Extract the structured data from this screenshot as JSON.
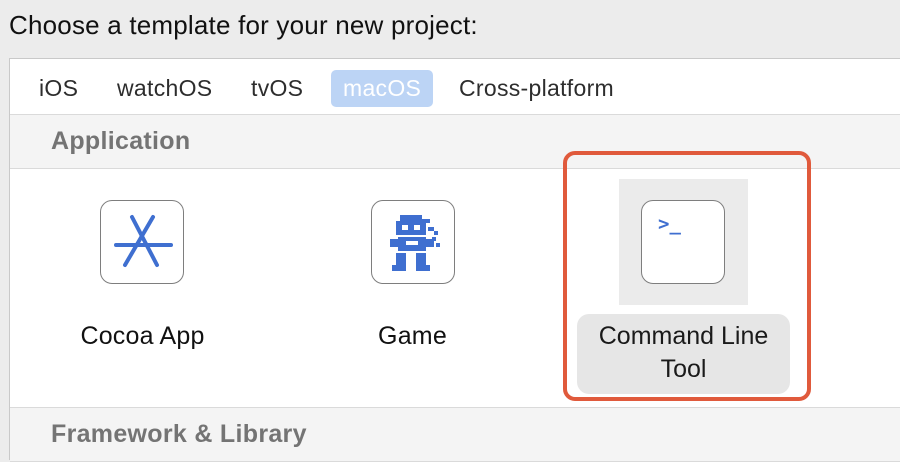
{
  "prompt": "Choose a template for your new project:",
  "tabs": [
    {
      "label": "iOS",
      "selected": false
    },
    {
      "label": "watchOS",
      "selected": false
    },
    {
      "label": "tvOS",
      "selected": false
    },
    {
      "label": "macOS",
      "selected": true
    },
    {
      "label": "Cross-platform",
      "selected": false
    }
  ],
  "sections": {
    "application": {
      "title": "Application",
      "templates": [
        {
          "label": "Cocoa App",
          "icon": "app-store-icon",
          "selected": false
        },
        {
          "label": "Game",
          "icon": "game-sprite-icon",
          "selected": false
        },
        {
          "label": "Command Line Tool",
          "icon": "terminal-icon",
          "selected": true
        }
      ]
    },
    "framework": {
      "title": "Framework & Library"
    }
  },
  "colors": {
    "tab_selected_bg": "#bcd4f5",
    "highlight_border": "#e05a3c",
    "icon_blue": "#3f6fd0"
  },
  "terminal_glyph": ">_"
}
